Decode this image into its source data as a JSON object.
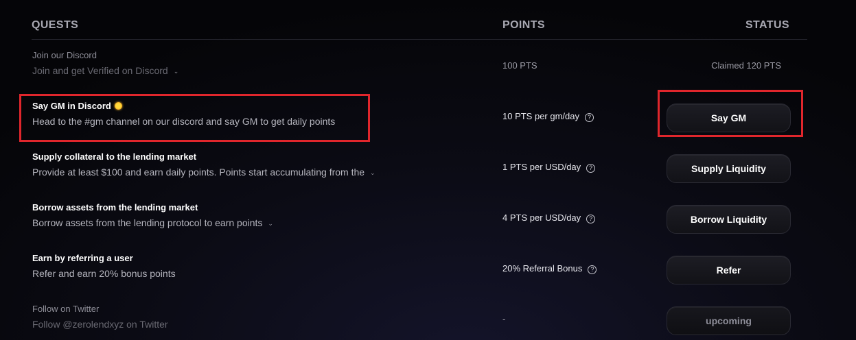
{
  "header": {
    "quests": "QUESTS",
    "points": "POINTS",
    "status": "STATUS"
  },
  "quests": [
    {
      "title": "Join our Discord",
      "description": "Join and get Verified on Discord",
      "points": "100 PTS",
      "status": "Claimed 120 PTS"
    },
    {
      "title": "Say GM in Discord",
      "description": "Head to the #gm channel on our discord and say GM to get daily points",
      "points": "10 PTS per gm/day",
      "button": "Say GM"
    },
    {
      "title": "Supply collateral to the lending market",
      "description": "Provide at least $100 and earn daily points. Points start accumulating from the",
      "points": "1 PTS per USD/day",
      "button": "Supply Liquidity"
    },
    {
      "title": "Borrow assets from the lending market",
      "description": "Borrow assets from the lending protocol to earn points",
      "points": "4 PTS per USD/day",
      "button": "Borrow Liquidity"
    },
    {
      "title": "Earn by referring a user",
      "description": "Refer and earn 20% bonus points",
      "points": "20% Referral Bonus",
      "button": "Refer"
    },
    {
      "title": "Follow on Twitter",
      "description": "Follow @zerolendxyz on Twitter",
      "points": "-",
      "button": "upcoming"
    }
  ],
  "icons": {
    "chevron": "chevron-down-icon",
    "info": "info-icon",
    "sun": "sun-emoji-icon"
  },
  "colors": {
    "highlight": "#e0262c",
    "background": "#050508"
  }
}
